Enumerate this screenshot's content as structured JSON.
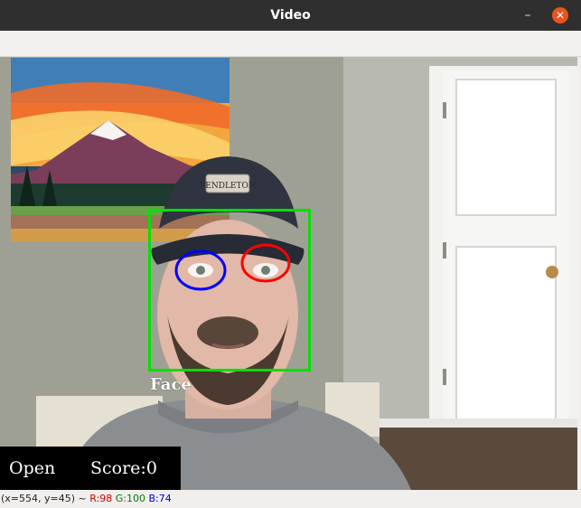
{
  "window": {
    "title": "Video",
    "minimize_icon": "minimize-icon",
    "close_icon": "close-icon",
    "close_color": "#e95420"
  },
  "overlay": {
    "state_label": "Open",
    "score_label": "Score:0"
  },
  "detection": {
    "face_label": "Face",
    "face_box_color": "#00e000",
    "left_eye_color": "#0000ff",
    "right_eye_color": "#ff0000"
  },
  "status": {
    "coords": "(x=554, y=45) ~",
    "r": "R:98",
    "g": "G:100",
    "b": "B:74"
  }
}
